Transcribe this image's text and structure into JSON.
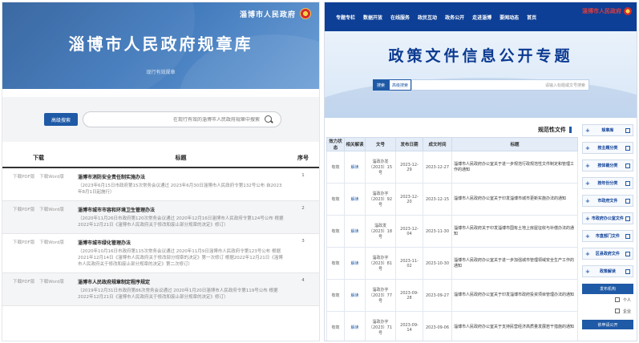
{
  "left": {
    "site_name": "淄博市人民政府",
    "page_title": "淄博市人民政府规章库",
    "sub_note": "现行有效规章",
    "search": {
      "button_label": "高级搜索",
      "placeholder": "在现行有效的淄博市人民政府规章中搜索"
    },
    "table": {
      "headers": {
        "no": "序号",
        "title": "标题",
        "download": "下载"
      },
      "rows": [
        {
          "no": "1",
          "title": "淄博市消防安全责任制实施办法",
          "desc": "（2023年6月15日市政府第15次常务会议通过 2023年6月30日淄博市人民政府令第132号公布 自2023年8月1日起施行）",
          "dl_word": "下载Word版",
          "dl_pdf": "下载PDF版"
        },
        {
          "no": "2",
          "title": "淄博市城市市容和环境卫生管理办法",
          "desc": "（2020年11月26日市政府第120次常务会议通过 2020年12月16日淄博市人民政府令第124号公布 根据2022年12月21日《淄博市人民政府关于修改和废止部分规章的决定》修订）",
          "dl_word": "下载Word版",
          "dl_pdf": "下载PDF版"
        },
        {
          "no": "3",
          "title": "淄博市城市绿化管理办法",
          "desc": "（2020年10月16日市政府第115次常务会议通过 2020年11月9日淄博市人民政府令第123号公布 根据2021年12月14日《淄博市人民政府关于修改部分规章的决定》第一次修订 根据2022年12月21日《淄博市人民政府关于修改和废止部分规章的决定》第二次修订）",
          "dl_word": "下载Word版",
          "dl_pdf": "下载PDF版"
        },
        {
          "no": "4",
          "title": "淄博市人民政府规章制定程序规定",
          "desc": "（2019年12月31日市政府第86次常务会议通过 2020年1月20日淄博市人民政府令第119号公布 根据2022年12月21日《淄博市人民政府关于修改和废止部分规章的决定》修订）",
          "dl_word": "下载Word版",
          "dl_pdf": "下载PDF版"
        }
      ]
    }
  },
  "right": {
    "gov_text": "淄博市人民政府",
    "nav_items": [
      "首页",
      "要闻动态",
      "走进淄博",
      "政务公开",
      "政民互动",
      "在线服务",
      "数据开放",
      "专题专栏"
    ],
    "hero_title": "政策文件信息公开专题",
    "hero_search": {
      "btn1": "搜索",
      "btn2": "高级搜索",
      "placeholder": "请输入标题或文号搜索"
    },
    "section_title": "规范性文件",
    "table": {
      "headers": {
        "title": "标题",
        "issue_date": "成文时间",
        "pub_date": "发布日期",
        "doc_no": "文号",
        "interp": "相关解读",
        "status": "效力状态"
      },
      "rows": [
        {
          "title": "淄博市人民政府办公室关于进一步规范行政规范性文件制定和管理工作的通知",
          "issue_date": "2023-12-27",
          "pub_date": "2023-12-29",
          "doc_no": "淄政办发〔2023〕15号",
          "interp": "解读",
          "status": "有效"
        },
        {
          "title": "淄博市人民政府办公室关于印发淄博市城市更新实施办法的通知",
          "issue_date": "2023-12-15",
          "pub_date": "2023-12-20",
          "doc_no": "淄政办字〔2023〕92号",
          "interp": "解读",
          "status": "有效"
        },
        {
          "title": "淄博市人民政府关于印发淄博市国有土地上房屋征收与补偿办法的通知",
          "issue_date": "2023-11-30",
          "pub_date": "2023-12-04",
          "doc_no": "淄政发〔2023〕18号",
          "interp": "解读",
          "status": "有效"
        },
        {
          "title": "淄博市人民政府办公室关于进一步加强城市管理领域安全生产工作的通知",
          "issue_date": "2023-10-30",
          "pub_date": "2023-11-02",
          "doc_no": "淄政办字〔2023〕81号",
          "interp": "解读",
          "status": "有效"
        },
        {
          "title": "淄博市人民政府办公室关于印发淄博市政府投资项目管理办法的通知",
          "issue_date": "2023-09-27",
          "pub_date": "2023-09-28",
          "doc_no": "淄政办字〔2023〕77号",
          "interp": "解读",
          "status": "有效"
        },
        {
          "title": "淄博市人民政府办公室关于支持民营经济高质量发展若干措施的通知",
          "issue_date": "2023-09-06",
          "pub_date": "2023-09-14",
          "doc_no": "淄政办字〔2023〕71号",
          "interp": "解读",
          "status": "有效"
        }
      ]
    },
    "side": {
      "items": [
        "规章库",
        "按主题分类",
        "按体裁分类",
        "按年份分类",
        "政府文件",
        "市政府文件",
        "市政府办公室文件",
        "部门文件",
        "市直部门文件",
        "区县政府文件",
        "政策解读"
      ],
      "pub_head": "发布机构",
      "opt1": "个人",
      "opt2": "企业",
      "apply": "依申请公开"
    }
  }
}
